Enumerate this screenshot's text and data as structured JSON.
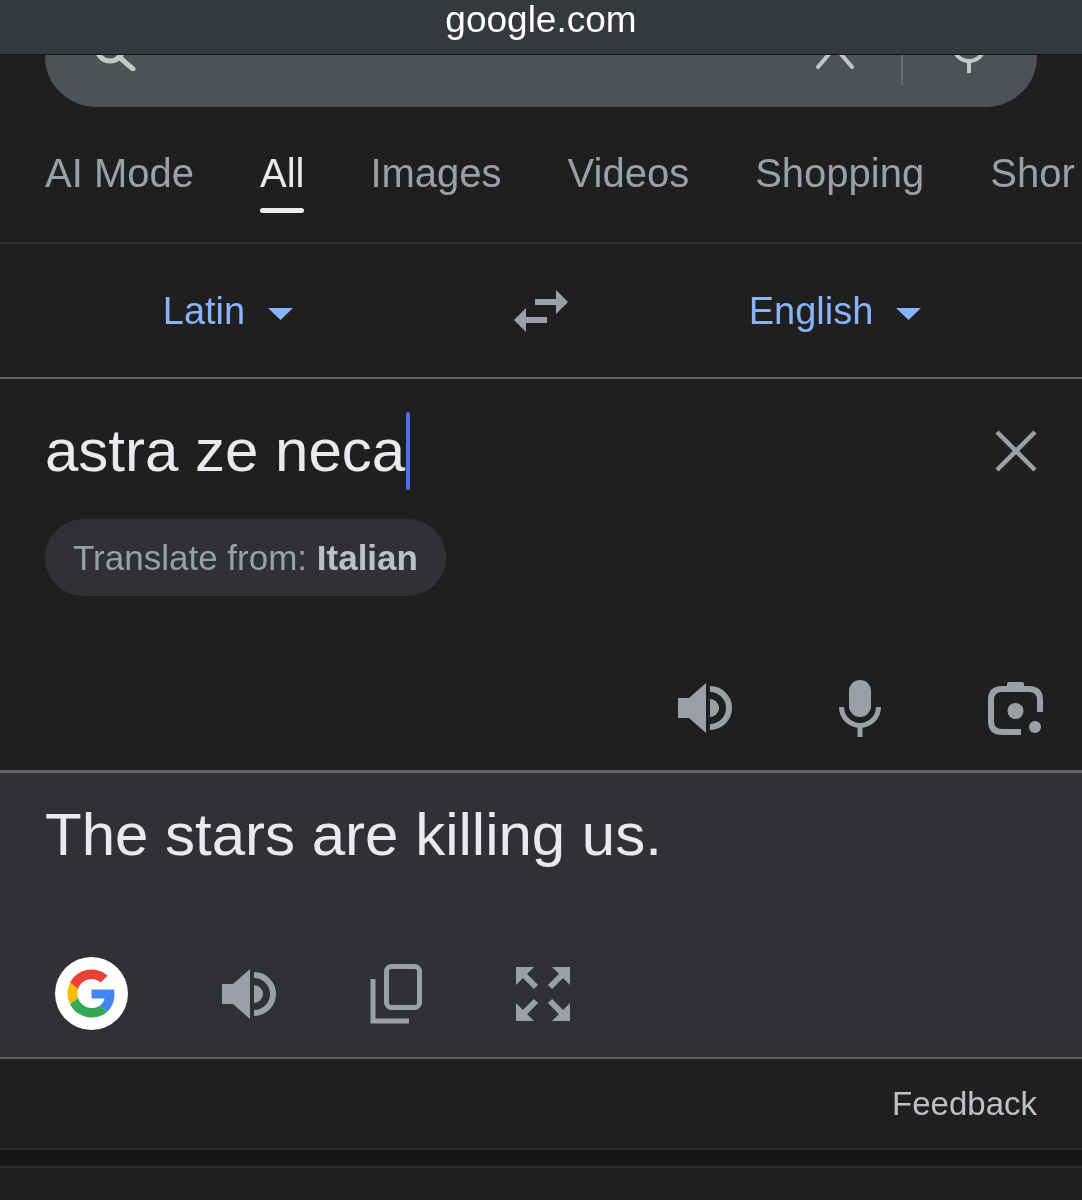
{
  "address_bar": {
    "url": "google.com"
  },
  "tabs": [
    {
      "label": "AI Mode",
      "selected": false
    },
    {
      "label": "All",
      "selected": true
    },
    {
      "label": "Images",
      "selected": false
    },
    {
      "label": "Videos",
      "selected": false
    },
    {
      "label": "Shopping",
      "selected": false
    },
    {
      "label": "Shor",
      "selected": false
    }
  ],
  "languages": {
    "source": "Latin",
    "target": "English"
  },
  "source_panel": {
    "text": "astra ze neca",
    "focused": true,
    "suggestion_chip": "Translate from: **Italian**"
  },
  "result_panel": {
    "text": "The stars are killing us."
  },
  "feedback_link": "Feedback"
}
